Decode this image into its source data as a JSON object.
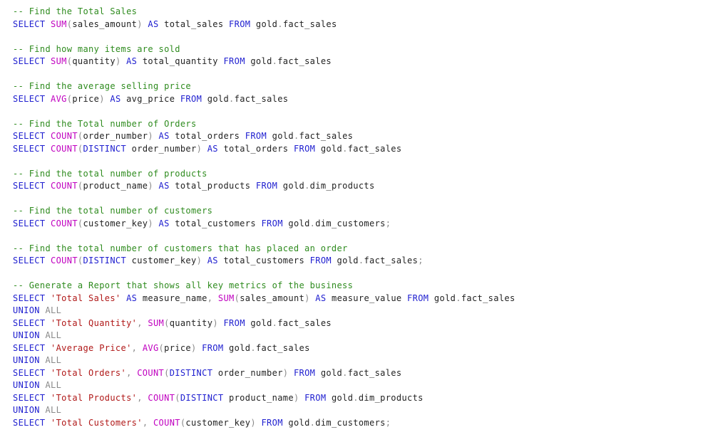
{
  "colors": {
    "keyword": "#2020d0",
    "function": "#c000c0",
    "string": "#b01818",
    "comment": "#2e8b1e",
    "operator": "#8a8a8a",
    "identifier": "#222222",
    "background": "#ffffff"
  },
  "lines": [
    [
      [
        "c",
        "-- Find the Total Sales"
      ]
    ],
    [
      [
        "k",
        "SELECT"
      ],
      [
        "i",
        " "
      ],
      [
        "f",
        "SUM"
      ],
      [
        "p",
        "("
      ],
      [
        "i",
        "sales_amount"
      ],
      [
        "p",
        ")"
      ],
      [
        "i",
        " "
      ],
      [
        "k",
        "AS"
      ],
      [
        "i",
        " total_sales "
      ],
      [
        "k",
        "FROM"
      ],
      [
        "i",
        " gold"
      ],
      [
        "p",
        "."
      ],
      [
        "i",
        "fact_sales"
      ]
    ],
    [],
    [
      [
        "c",
        "-- Find how many items are sold"
      ]
    ],
    [
      [
        "k",
        "SELECT"
      ],
      [
        "i",
        " "
      ],
      [
        "f",
        "SUM"
      ],
      [
        "p",
        "("
      ],
      [
        "i",
        "quantity"
      ],
      [
        "p",
        ")"
      ],
      [
        "i",
        " "
      ],
      [
        "k",
        "AS"
      ],
      [
        "i",
        " total_quantity "
      ],
      [
        "k",
        "FROM"
      ],
      [
        "i",
        " gold"
      ],
      [
        "p",
        "."
      ],
      [
        "i",
        "fact_sales"
      ]
    ],
    [],
    [
      [
        "c",
        "-- Find the average selling price"
      ]
    ],
    [
      [
        "k",
        "SELECT"
      ],
      [
        "i",
        " "
      ],
      [
        "f",
        "AVG"
      ],
      [
        "p",
        "("
      ],
      [
        "i",
        "price"
      ],
      [
        "p",
        ")"
      ],
      [
        "i",
        " "
      ],
      [
        "k",
        "AS"
      ],
      [
        "i",
        " avg_price "
      ],
      [
        "k",
        "FROM"
      ],
      [
        "i",
        " gold"
      ],
      [
        "p",
        "."
      ],
      [
        "i",
        "fact_sales"
      ]
    ],
    [],
    [
      [
        "c",
        "-- Find the Total number of Orders"
      ]
    ],
    [
      [
        "k",
        "SELECT"
      ],
      [
        "i",
        " "
      ],
      [
        "f",
        "COUNT"
      ],
      [
        "p",
        "("
      ],
      [
        "i",
        "order_number"
      ],
      [
        "p",
        ")"
      ],
      [
        "i",
        " "
      ],
      [
        "k",
        "AS"
      ],
      [
        "i",
        " total_orders "
      ],
      [
        "k",
        "FROM"
      ],
      [
        "i",
        " gold"
      ],
      [
        "p",
        "."
      ],
      [
        "i",
        "fact_sales"
      ]
    ],
    [
      [
        "k",
        "SELECT"
      ],
      [
        "i",
        " "
      ],
      [
        "f",
        "COUNT"
      ],
      [
        "p",
        "("
      ],
      [
        "k",
        "DISTINCT"
      ],
      [
        "i",
        " order_number"
      ],
      [
        "p",
        ")"
      ],
      [
        "i",
        " "
      ],
      [
        "k",
        "AS"
      ],
      [
        "i",
        " total_orders "
      ],
      [
        "k",
        "FROM"
      ],
      [
        "i",
        " gold"
      ],
      [
        "p",
        "."
      ],
      [
        "i",
        "fact_sales"
      ]
    ],
    [],
    [
      [
        "c",
        "-- Find the total number of products"
      ]
    ],
    [
      [
        "k",
        "SELECT"
      ],
      [
        "i",
        " "
      ],
      [
        "f",
        "COUNT"
      ],
      [
        "p",
        "("
      ],
      [
        "i",
        "product_name"
      ],
      [
        "p",
        ")"
      ],
      [
        "i",
        " "
      ],
      [
        "k",
        "AS"
      ],
      [
        "i",
        " total_products "
      ],
      [
        "k",
        "FROM"
      ],
      [
        "i",
        " gold"
      ],
      [
        "p",
        "."
      ],
      [
        "i",
        "dim_products"
      ]
    ],
    [],
    [
      [
        "c",
        "-- Find the total number of customers"
      ]
    ],
    [
      [
        "k",
        "SELECT"
      ],
      [
        "i",
        " "
      ],
      [
        "f",
        "COUNT"
      ],
      [
        "p",
        "("
      ],
      [
        "i",
        "customer_key"
      ],
      [
        "p",
        ")"
      ],
      [
        "i",
        " "
      ],
      [
        "k",
        "AS"
      ],
      [
        "i",
        " total_customers "
      ],
      [
        "k",
        "FROM"
      ],
      [
        "i",
        " gold"
      ],
      [
        "p",
        "."
      ],
      [
        "i",
        "dim_customers"
      ],
      [
        "p",
        ";"
      ]
    ],
    [],
    [
      [
        "c",
        "-- Find the total number of customers that has placed an order"
      ]
    ],
    [
      [
        "k",
        "SELECT"
      ],
      [
        "i",
        " "
      ],
      [
        "f",
        "COUNT"
      ],
      [
        "p",
        "("
      ],
      [
        "k",
        "DISTINCT"
      ],
      [
        "i",
        " customer_key"
      ],
      [
        "p",
        ")"
      ],
      [
        "i",
        " "
      ],
      [
        "k",
        "AS"
      ],
      [
        "i",
        " total_customers "
      ],
      [
        "k",
        "FROM"
      ],
      [
        "i",
        " gold"
      ],
      [
        "p",
        "."
      ],
      [
        "i",
        "fact_sales"
      ],
      [
        "p",
        ";"
      ]
    ],
    [],
    [
      [
        "c",
        "-- Generate a Report that shows all key metrics of the business"
      ]
    ],
    [
      [
        "k",
        "SELECT"
      ],
      [
        "i",
        " "
      ],
      [
        "s",
        "'Total Sales'"
      ],
      [
        "i",
        " "
      ],
      [
        "k",
        "AS"
      ],
      [
        "i",
        " measure_name"
      ],
      [
        "p",
        ","
      ],
      [
        "i",
        " "
      ],
      [
        "f",
        "SUM"
      ],
      [
        "p",
        "("
      ],
      [
        "i",
        "sales_amount"
      ],
      [
        "p",
        ")"
      ],
      [
        "i",
        " "
      ],
      [
        "k",
        "AS"
      ],
      [
        "i",
        " measure_value "
      ],
      [
        "k",
        "FROM"
      ],
      [
        "i",
        " gold"
      ],
      [
        "p",
        "."
      ],
      [
        "i",
        "fact_sales"
      ]
    ],
    [
      [
        "k",
        "UNION"
      ],
      [
        "i",
        " "
      ],
      [
        "g",
        "ALL"
      ]
    ],
    [
      [
        "k",
        "SELECT"
      ],
      [
        "i",
        " "
      ],
      [
        "s",
        "'Total Quantity'"
      ],
      [
        "p",
        ","
      ],
      [
        "i",
        " "
      ],
      [
        "f",
        "SUM"
      ],
      [
        "p",
        "("
      ],
      [
        "i",
        "quantity"
      ],
      [
        "p",
        ")"
      ],
      [
        "i",
        " "
      ],
      [
        "k",
        "FROM"
      ],
      [
        "i",
        " gold"
      ],
      [
        "p",
        "."
      ],
      [
        "i",
        "fact_sales"
      ]
    ],
    [
      [
        "k",
        "UNION"
      ],
      [
        "i",
        " "
      ],
      [
        "g",
        "ALL"
      ]
    ],
    [
      [
        "k",
        "SELECT"
      ],
      [
        "i",
        " "
      ],
      [
        "s",
        "'Average Price'"
      ],
      [
        "p",
        ","
      ],
      [
        "i",
        " "
      ],
      [
        "f",
        "AVG"
      ],
      [
        "p",
        "("
      ],
      [
        "i",
        "price"
      ],
      [
        "p",
        ")"
      ],
      [
        "i",
        " "
      ],
      [
        "k",
        "FROM"
      ],
      [
        "i",
        " gold"
      ],
      [
        "p",
        "."
      ],
      [
        "i",
        "fact_sales"
      ]
    ],
    [
      [
        "k",
        "UNION"
      ],
      [
        "i",
        " "
      ],
      [
        "g",
        "ALL"
      ]
    ],
    [
      [
        "k",
        "SELECT"
      ],
      [
        "i",
        " "
      ],
      [
        "s",
        "'Total Orders'"
      ],
      [
        "p",
        ","
      ],
      [
        "i",
        " "
      ],
      [
        "f",
        "COUNT"
      ],
      [
        "p",
        "("
      ],
      [
        "k",
        "DISTINCT"
      ],
      [
        "i",
        " order_number"
      ],
      [
        "p",
        ")"
      ],
      [
        "i",
        " "
      ],
      [
        "k",
        "FROM"
      ],
      [
        "i",
        " gold"
      ],
      [
        "p",
        "."
      ],
      [
        "i",
        "fact_sales"
      ]
    ],
    [
      [
        "k",
        "UNION"
      ],
      [
        "i",
        " "
      ],
      [
        "g",
        "ALL"
      ]
    ],
    [
      [
        "k",
        "SELECT"
      ],
      [
        "i",
        " "
      ],
      [
        "s",
        "'Total Products'"
      ],
      [
        "p",
        ","
      ],
      [
        "i",
        " "
      ],
      [
        "f",
        "COUNT"
      ],
      [
        "p",
        "("
      ],
      [
        "k",
        "DISTINCT"
      ],
      [
        "i",
        " product_name"
      ],
      [
        "p",
        ")"
      ],
      [
        "i",
        " "
      ],
      [
        "k",
        "FROM"
      ],
      [
        "i",
        " gold"
      ],
      [
        "p",
        "."
      ],
      [
        "i",
        "dim_products"
      ]
    ],
    [
      [
        "k",
        "UNION"
      ],
      [
        "i",
        " "
      ],
      [
        "g",
        "ALL"
      ]
    ],
    [
      [
        "k",
        "SELECT"
      ],
      [
        "i",
        " "
      ],
      [
        "s",
        "'Total Customers'"
      ],
      [
        "p",
        ","
      ],
      [
        "i",
        " "
      ],
      [
        "f",
        "COUNT"
      ],
      [
        "p",
        "("
      ],
      [
        "i",
        "customer_key"
      ],
      [
        "p",
        ")"
      ],
      [
        "i",
        " "
      ],
      [
        "k",
        "FROM"
      ],
      [
        "i",
        " gold"
      ],
      [
        "p",
        "."
      ],
      [
        "i",
        "dim_customers"
      ],
      [
        "p",
        ";"
      ]
    ]
  ]
}
